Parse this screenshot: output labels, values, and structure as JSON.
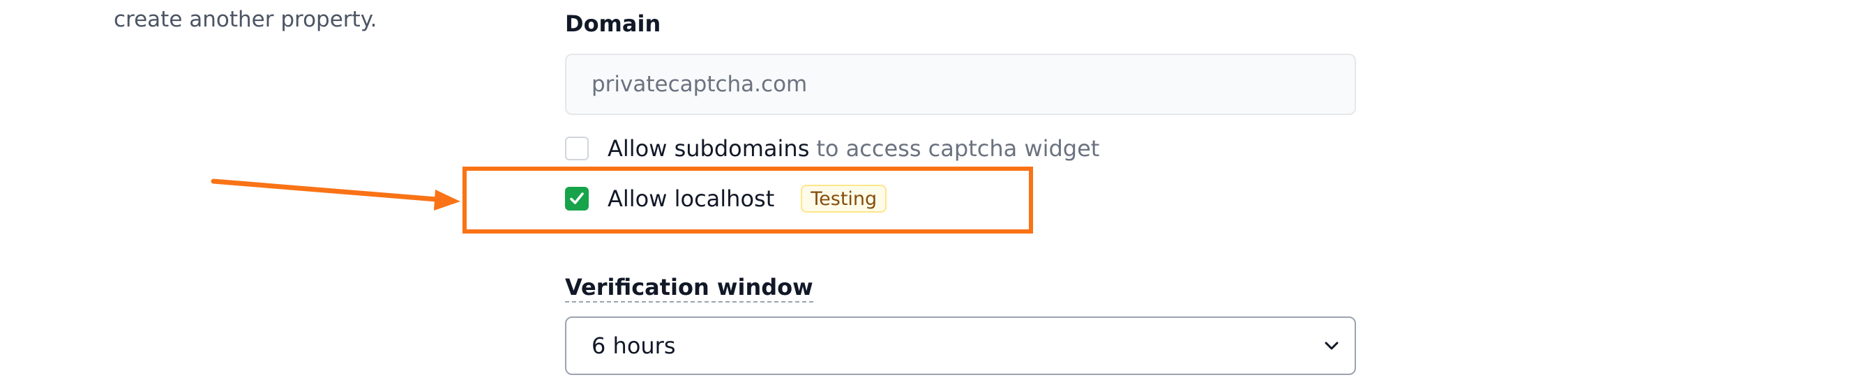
{
  "sidebar": {
    "help_text": "create another property."
  },
  "domain": {
    "label": "Domain",
    "placeholder": "privatecaptcha.com"
  },
  "options": {
    "allow_subdomains": {
      "label": "Allow subdomains",
      "hint": "to access captcha widget",
      "checked": false
    },
    "allow_localhost": {
      "label": "Allow localhost",
      "badge": "Testing",
      "checked": true
    }
  },
  "verification_window": {
    "label": "Verification window",
    "selected": "6 hours"
  },
  "colors": {
    "accent_annotation": "#f97316",
    "checked_green": "#16a34a",
    "badge_bg": "#fefce8",
    "badge_text": "#854d0e"
  },
  "icons": {
    "checkbox_checked": "check-icon",
    "select": "chevron-down-icon",
    "annotation": "arrow-right-icon"
  }
}
